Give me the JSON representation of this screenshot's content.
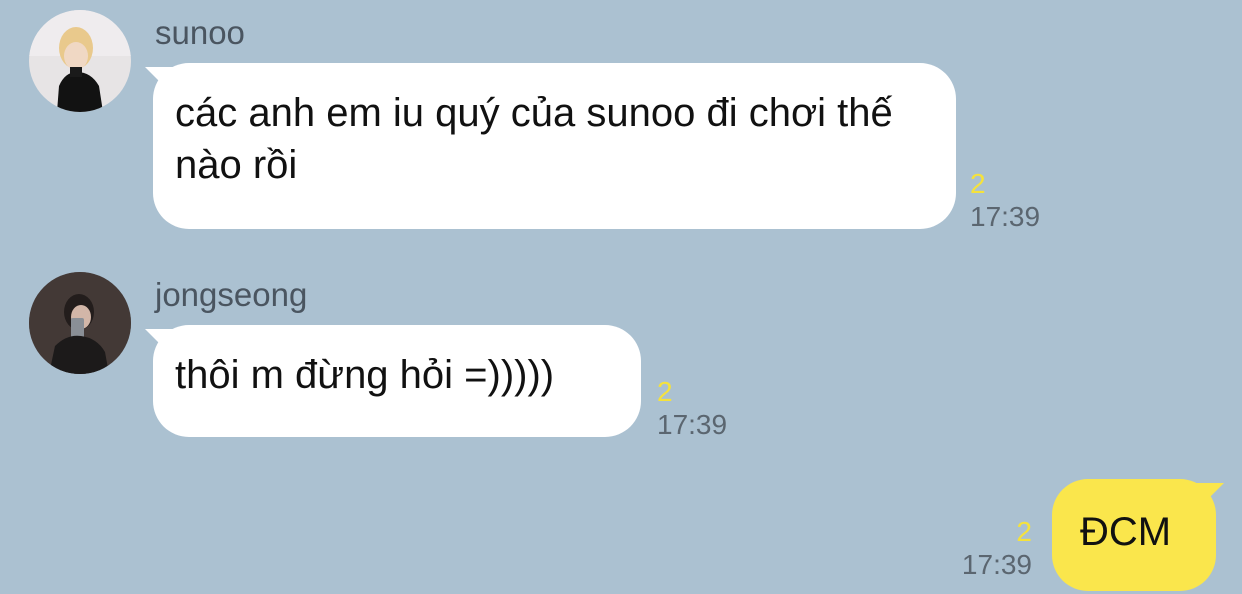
{
  "chat": {
    "colors": {
      "background": "#abc1d1",
      "incoming_bubble": "#ffffff",
      "outgoing_bubble": "#fae64c",
      "unread_count": "#f5e23c",
      "timestamp": "#5b6670"
    },
    "messages": [
      {
        "direction": "incoming",
        "sender": "sunoo",
        "avatar": "user-avatar",
        "text": "các anh em iu quý của sunoo đi chơi thế nào rồi",
        "unread": "2",
        "time": "17:39"
      },
      {
        "direction": "incoming",
        "sender": "jongseong",
        "avatar": "user-avatar",
        "text": "thôi m đừng hỏi =)))))",
        "unread": "2",
        "time": "17:39"
      },
      {
        "direction": "outgoing",
        "text": "ĐCM",
        "unread": "2",
        "time": "17:39"
      }
    ]
  }
}
